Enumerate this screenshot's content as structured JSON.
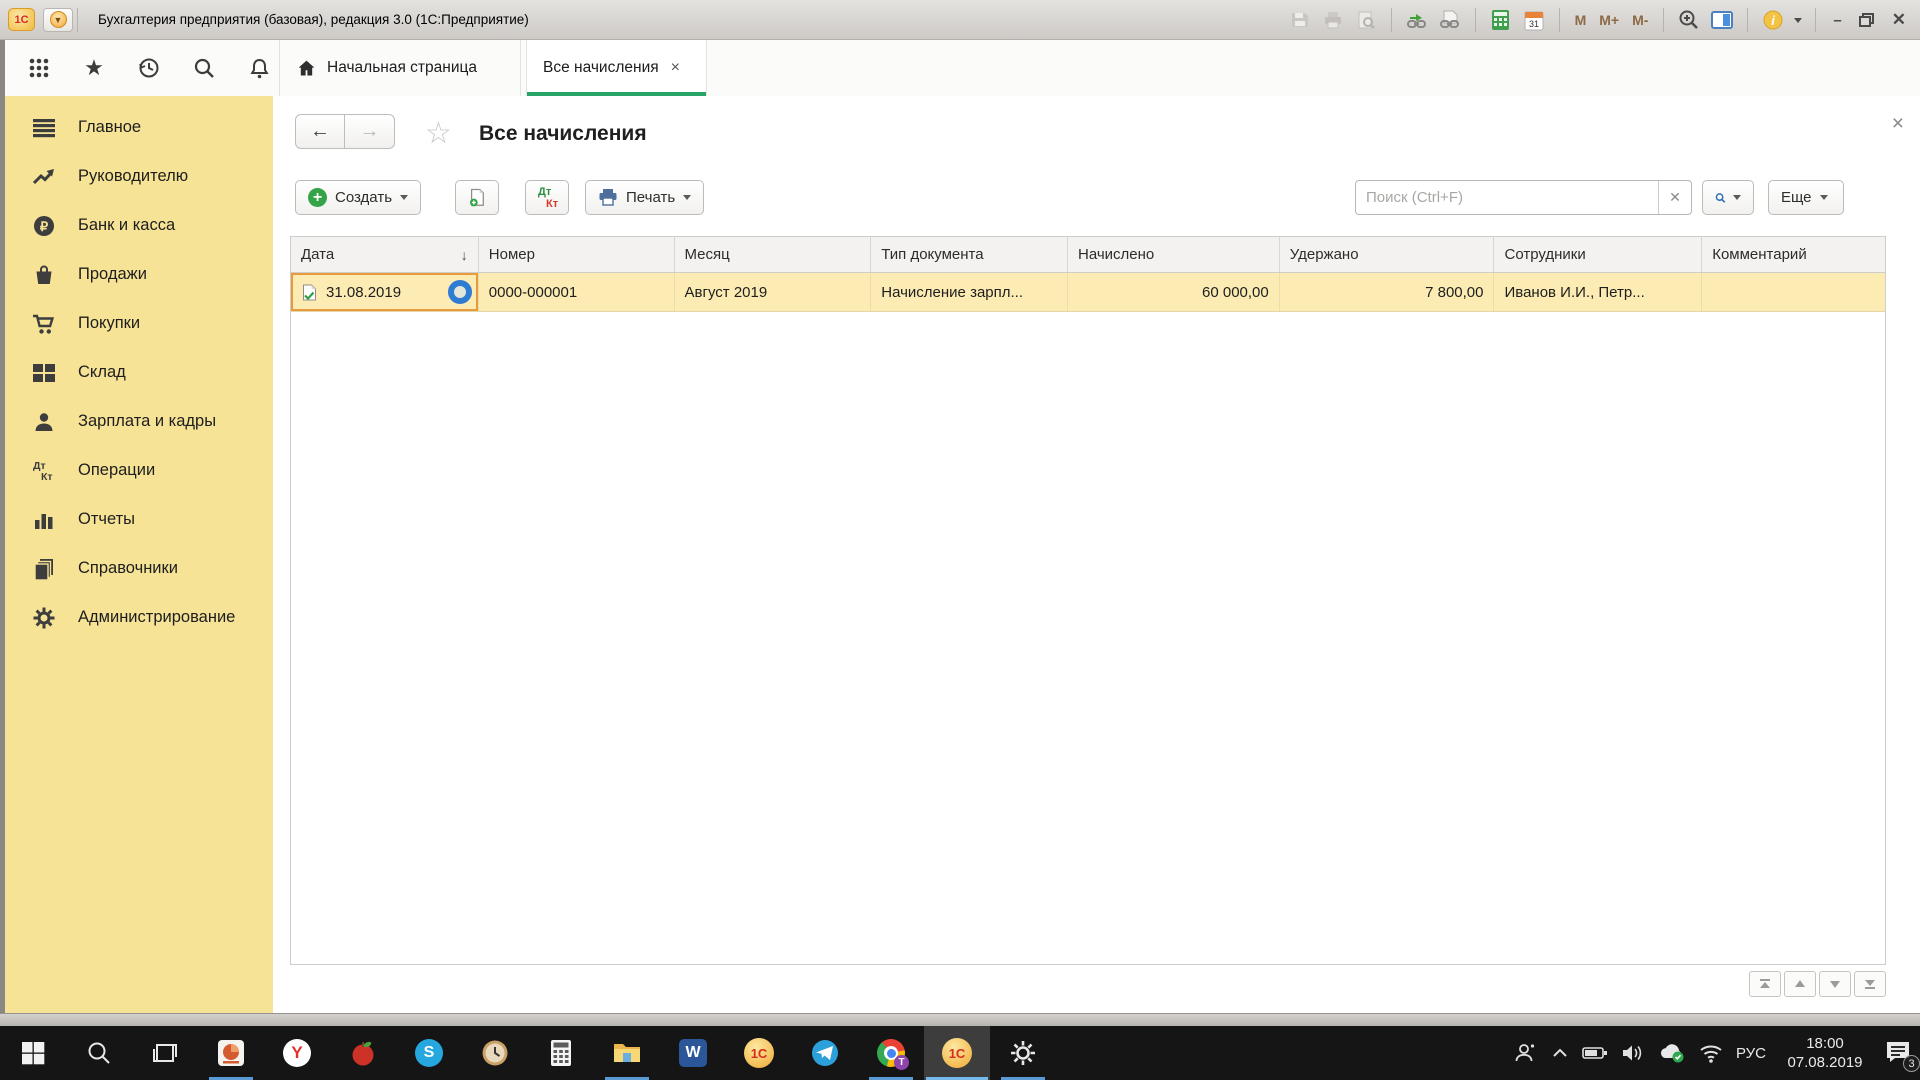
{
  "colors": {
    "sidebar_bg": "#f6e396",
    "tab_accent_green": "#27a567",
    "row_selection_bg": "#fcecb3",
    "cell_selection_border": "#e89b3c",
    "click_indicator_blue": "#2f7cd3",
    "taskbar_bg": "#151515"
  },
  "glyphs": {
    "dt": "Дт",
    "kt": "Кт",
    "calendar_day": "31",
    "yandex": "Y",
    "skype": "S",
    "word": "W",
    "onec": "1С",
    "chrome_badge": "T"
  },
  "title_bar": {
    "title": "Бухгалтерия предприятия (базовая), редакция 3.0  (1С:Предприятие)",
    "m": "M",
    "m_plus": "M+",
    "m_minus": "M-"
  },
  "tab_bar": {
    "tabs": [
      {
        "label": "Начальная страница"
      },
      {
        "label": "Все начисления",
        "active": true,
        "closable": true
      }
    ]
  },
  "sidebar": {
    "items": [
      "Главное",
      "Руководителю",
      "Банк и касса",
      "Продажи",
      "Покупки",
      "Склад",
      "Зарплата и кадры",
      "Операции",
      "Отчеты",
      "Справочники",
      "Администрирование"
    ]
  },
  "content": {
    "title": "Все начисления",
    "toolbar": {
      "create": "Создать",
      "print": "Печать",
      "more": "Еще",
      "search_placeholder": "Поиск (Ctrl+F)"
    },
    "table": {
      "columns": [
        "Дата",
        "Номер",
        "Месяц",
        "Тип документа",
        "Начислено",
        "Удержано",
        "Сотрудники",
        "Комментарий"
      ],
      "sorted_by": "Дата",
      "rows": [
        {
          "date": "31.08.2019",
          "number": "0000-000001",
          "month": "Август 2019",
          "doc_type": "Начисление зарпл...",
          "accrued": "60 000,00",
          "withheld": "7 800,00",
          "employees": "Иванов И.И., Петр...",
          "comment": ""
        }
      ]
    }
  },
  "taskbar": {
    "tray": {
      "lang": "РУС",
      "time": "18:00",
      "date": "07.08.2019",
      "notification_count": "3"
    }
  }
}
